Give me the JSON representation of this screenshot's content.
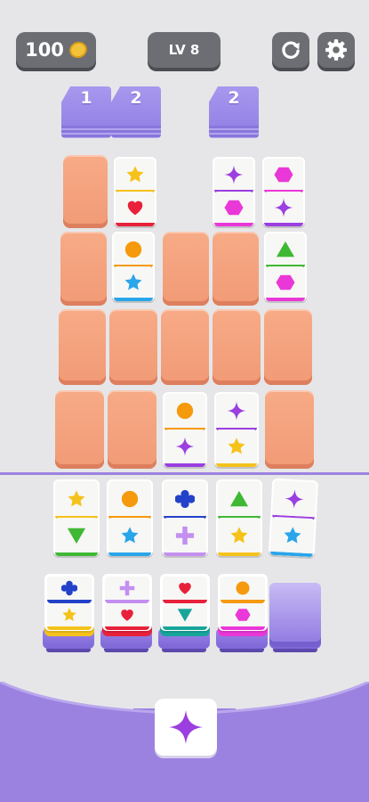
{
  "header": {
    "coins": "100",
    "level": "LV 8"
  },
  "stacks": [
    {
      "count": "1"
    },
    {
      "count": "2"
    },
    {
      "count": "2"
    }
  ],
  "colors": {
    "yellow": "#f5c21b",
    "red": "#e8213a",
    "purple": "#9b3fe0",
    "magenta": "#ea37d7",
    "orange": "#f59a0d",
    "blue": "#29a5ea",
    "green": "#3fb834",
    "darkblue": "#2341c9",
    "lavender": "#c48ff0",
    "teal": "#17a59a",
    "board_tile": "#f5a27f",
    "accent": "#9c82e0"
  },
  "icons": {
    "coin": "coin-icon",
    "restart": "restart-icon",
    "settings": "gear-icon"
  },
  "next_tile_symbol": "star"
}
